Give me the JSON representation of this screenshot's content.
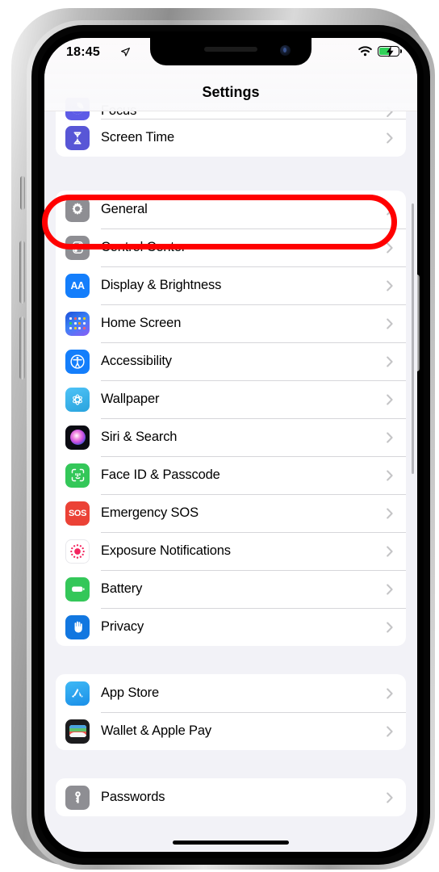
{
  "device": {
    "frame": "iphone-with-notch",
    "buttons": [
      "mute-switch",
      "volume-up",
      "volume-down",
      "power"
    ]
  },
  "status_bar": {
    "time": "18:45",
    "location_icon": "location-arrow-icon",
    "wifi_icon": "wifi-icon",
    "battery_icon": "battery-charging-icon",
    "battery_color": "#30d158"
  },
  "header": {
    "title": "Settings"
  },
  "groups": [
    {
      "name": "group-focus-screentime",
      "partial_top": true,
      "rows": [
        {
          "label": "Focus",
          "icon": "focus-icon",
          "icon_class": "i-focus",
          "clipped": true
        },
        {
          "label": "Screen Time",
          "icon": "hourglass-icon",
          "icon_class": "i-screentime",
          "clipped": false
        }
      ]
    },
    {
      "name": "group-system",
      "partial_top": false,
      "rows": [
        {
          "label": "General",
          "icon": "gear-icon",
          "icon_class": "i-general",
          "highlighted": true
        },
        {
          "label": "Control Center",
          "icon": "control-center-icon",
          "icon_class": "i-control"
        },
        {
          "label": "Display & Brightness",
          "icon": "display-brightness-icon",
          "icon_class": "i-display"
        },
        {
          "label": "Home Screen",
          "icon": "home-screen-icon",
          "icon_class": "i-home"
        },
        {
          "label": "Accessibility",
          "icon": "accessibility-icon",
          "icon_class": "i-access"
        },
        {
          "label": "Wallpaper",
          "icon": "wallpaper-icon",
          "icon_class": "i-wallpaper"
        },
        {
          "label": "Siri & Search",
          "icon": "siri-icon",
          "icon_class": "i-siri"
        },
        {
          "label": "Face ID & Passcode",
          "icon": "face-id-icon",
          "icon_class": "i-faceid"
        },
        {
          "label": "Emergency SOS",
          "icon": "sos-icon",
          "icon_class": "i-sos",
          "icon_text": "SOS"
        },
        {
          "label": "Exposure Notifications",
          "icon": "exposure-notifications-icon",
          "icon_class": "i-exposure"
        },
        {
          "label": "Battery",
          "icon": "battery-icon",
          "icon_class": "i-battery"
        },
        {
          "label": "Privacy",
          "icon": "privacy-hand-icon",
          "icon_class": "i-privacy"
        }
      ]
    },
    {
      "name": "group-store",
      "partial_top": false,
      "rows": [
        {
          "label": "App Store",
          "icon": "app-store-icon",
          "icon_class": "i-appstore"
        },
        {
          "label": "Wallet & Apple Pay",
          "icon": "wallet-icon",
          "icon_class": "i-wallet"
        }
      ]
    },
    {
      "name": "group-passwords",
      "partial_top": false,
      "rows": [
        {
          "label": "Passwords",
          "icon": "key-icon",
          "icon_class": "i-passwords"
        }
      ]
    }
  ],
  "annotation": {
    "shape": "rounded-rectangle-outline",
    "color": "#ff0000",
    "targets": "General"
  },
  "display_aa_label": "AA"
}
